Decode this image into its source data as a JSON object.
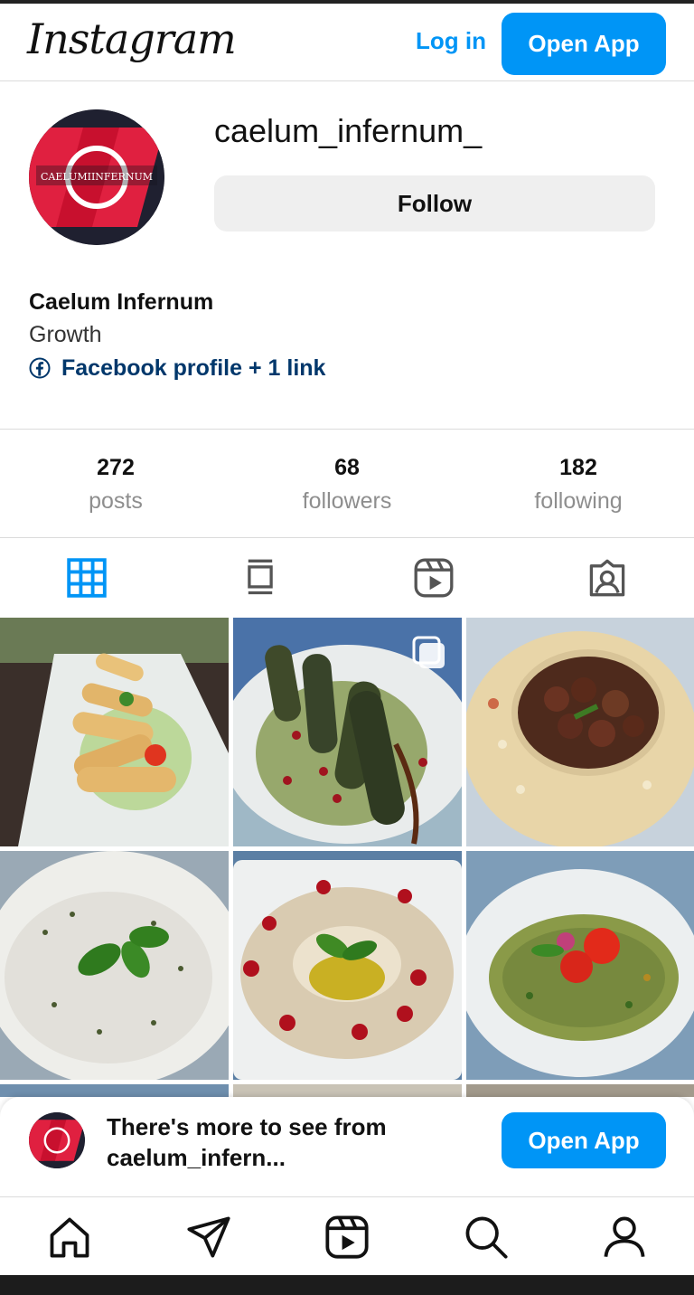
{
  "header": {
    "logo_text": "Instagram",
    "login_label": "Log in",
    "open_app_label": "Open App"
  },
  "profile": {
    "avatar_text": "CAELUMIINFERNUM",
    "username": "caelum_infernum_",
    "follow_label": "Follow",
    "full_name": "Caelum Infernum",
    "category": "Growth",
    "link_text": "Facebook profile + 1 link"
  },
  "stats": [
    {
      "value": "272",
      "label": "posts"
    },
    {
      "value": "68",
      "label": "followers"
    },
    {
      "value": "182",
      "label": "following"
    }
  ],
  "tabs": {
    "icons": [
      "grid-icon",
      "feed-icon",
      "reels-icon",
      "tagged-icon"
    ],
    "active": "grid-icon",
    "active_color": "#0095f6"
  },
  "posts": [
    {
      "icon": "photo",
      "multi": false
    },
    {
      "icon": "photo",
      "multi": true
    },
    {
      "icon": "photo",
      "multi": false
    },
    {
      "icon": "photo",
      "multi": false
    },
    {
      "icon": "photo",
      "multi": false
    },
    {
      "icon": "photo",
      "multi": false
    }
  ],
  "banner": {
    "text": "There's more to see from caelum_infern...",
    "open_app_label": "Open App"
  },
  "bottom_nav": {
    "icons": [
      "home-icon",
      "direct-icon",
      "reels-icon",
      "search-icon",
      "profile-icon"
    ]
  },
  "colors": {
    "accent": "#0095f6",
    "link": "#00376b",
    "muted": "#8e8e8e"
  }
}
